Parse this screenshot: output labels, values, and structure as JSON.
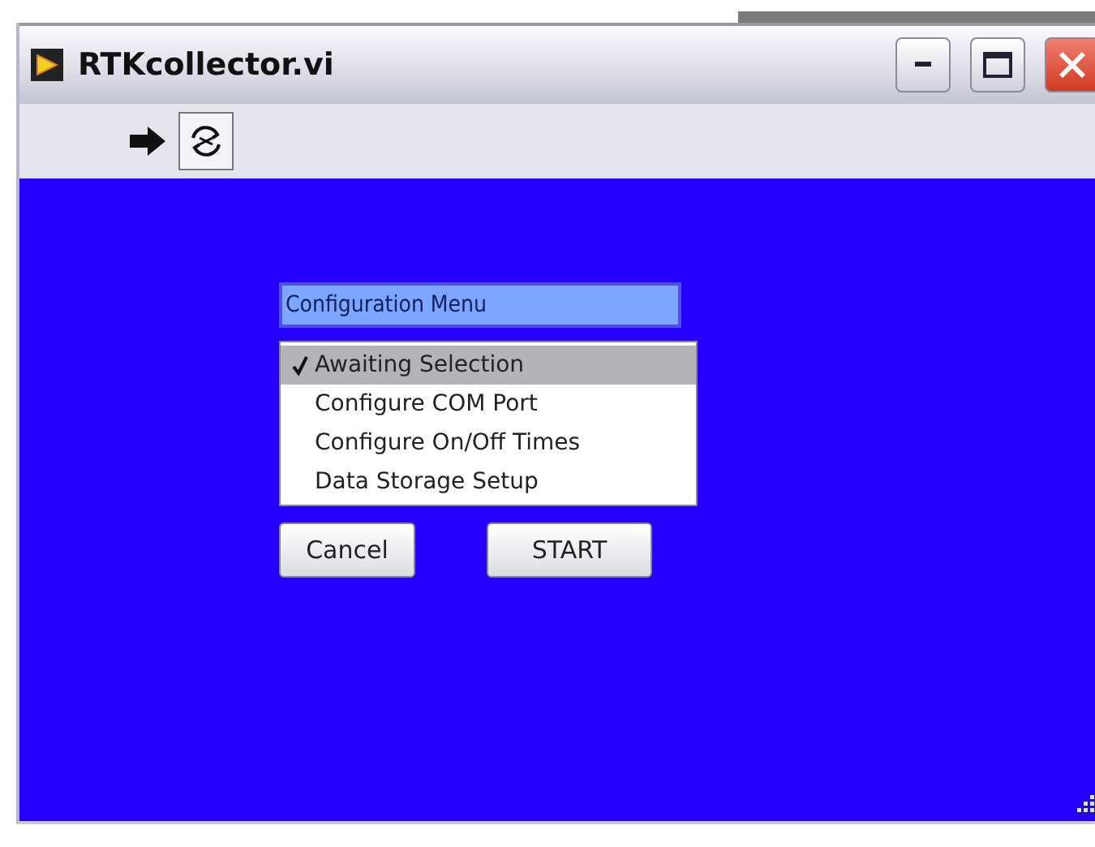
{
  "window": {
    "title": "RTKcollector.vi"
  },
  "panel": {
    "label": "Configuration Menu",
    "items": [
      {
        "label": "Awaiting Selection",
        "selected": true
      },
      {
        "label": "Configure COM Port",
        "selected": false
      },
      {
        "label": "Configure On/Off Times",
        "selected": false
      },
      {
        "label": "Data Storage Setup",
        "selected": false
      }
    ],
    "buttons": [
      "Cancel",
      "START"
    ]
  }
}
